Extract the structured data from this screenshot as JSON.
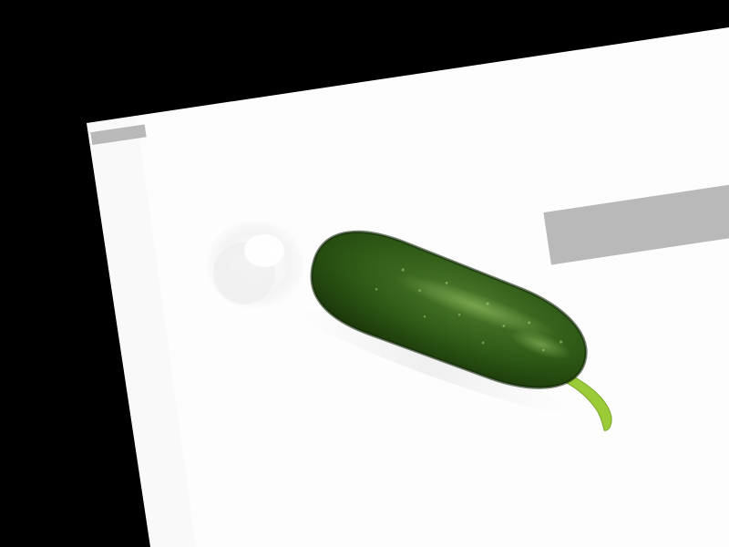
{
  "scene": {
    "subject": "cucumber-icon",
    "background_color": "#000000",
    "photo_color": "#fdfdfd"
  },
  "watermark_top_left": "",
  "watermark_badge": {
    "small_text": "",
    "large_text": ""
  },
  "colors": {
    "cucumber_dark": "#1f3f10",
    "cucumber_mid": "#3e6e22",
    "cucumber_light": "#8dbf5a",
    "stem": "#9ccb3a",
    "badge_bg": "#b9b9b9",
    "watermark_text": "#ffffff"
  }
}
